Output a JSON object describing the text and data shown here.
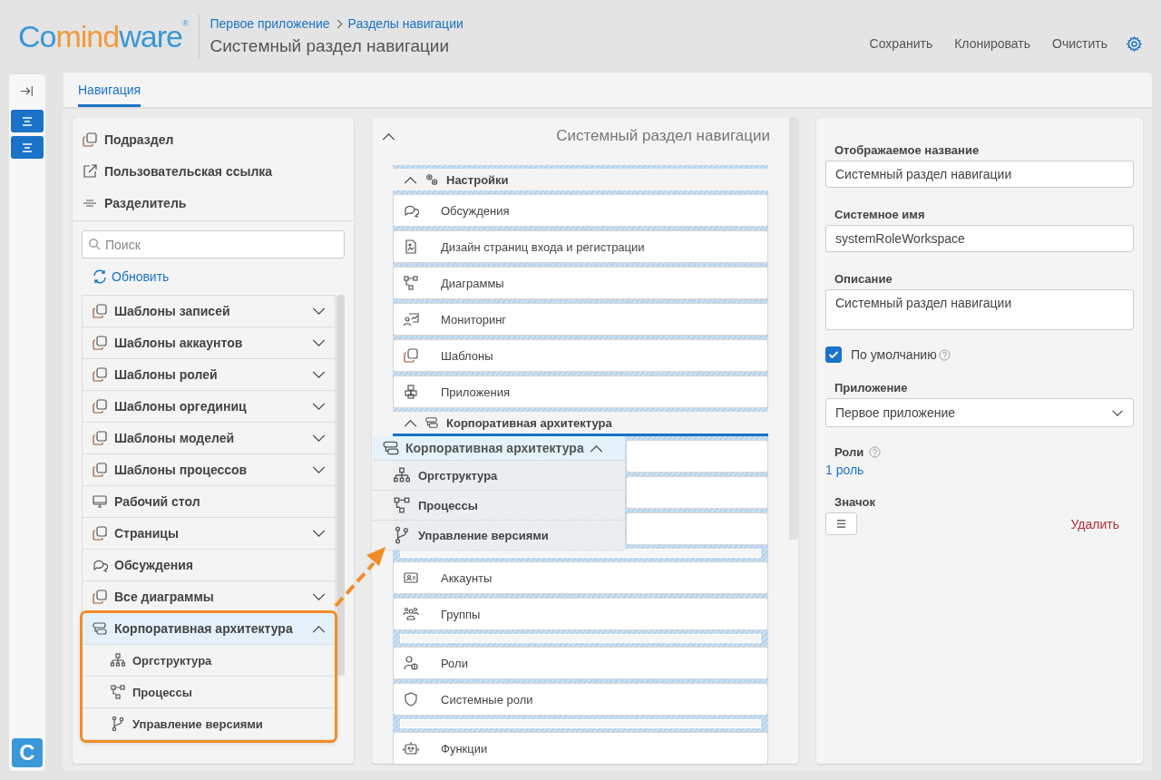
{
  "logo": {
    "parts": [
      {
        "text": "Co",
        "accent": false
      },
      {
        "text": "mind",
        "accent": true
      },
      {
        "text": "ware",
        "accent": false
      }
    ],
    "mark": "®"
  },
  "breadcrumbs": [
    "Первое приложение",
    "Разделы навигации"
  ],
  "page_title": "Системный раздел навигации",
  "actions": [
    "Сохранить",
    "Клонировать",
    "Очистить"
  ],
  "rail": {
    "buttons": [
      {
        "selected": true
      },
      {
        "selected": true
      }
    ],
    "app_badge": "C"
  },
  "tabs": [
    {
      "label": "Навигация",
      "selected": true
    }
  ],
  "palette": {
    "create_items": [
      {
        "kind": "subsection",
        "label": "Подраздел"
      },
      {
        "kind": "link",
        "label": "Пользовательская ссылка"
      },
      {
        "kind": "divider",
        "label": "Разделитель"
      }
    ],
    "search": {
      "placeholder": "Поиск"
    },
    "refresh": "Обновить",
    "items": [
      {
        "kind": "templates",
        "label": "Шаблоны записей",
        "expandable": true,
        "expanded": false,
        "selected": false,
        "annotated": false
      },
      {
        "kind": "templates",
        "label": "Шаблоны аккаунтов",
        "expandable": true,
        "expanded": false,
        "selected": false,
        "annotated": false
      },
      {
        "kind": "templates",
        "label": "Шаблоны ролей",
        "expandable": true,
        "expanded": false,
        "selected": false,
        "annotated": false
      },
      {
        "kind": "templates",
        "label": "Шаблоны оргединиц",
        "expandable": true,
        "expanded": false,
        "selected": false,
        "annotated": false
      },
      {
        "kind": "templates",
        "label": "Шаблоны моделей",
        "expandable": true,
        "expanded": false,
        "selected": false,
        "annotated": false
      },
      {
        "kind": "templates",
        "label": "Шаблоны процессов",
        "expandable": true,
        "expanded": false,
        "selected": false,
        "annotated": false
      },
      {
        "kind": "desktop",
        "label": "Рабочий стол",
        "expandable": false,
        "selected": false,
        "annotated": false
      },
      {
        "kind": "templates",
        "label": "Страницы",
        "expandable": true,
        "expanded": false,
        "selected": false,
        "annotated": false
      },
      {
        "kind": "discussions",
        "label": "Обсуждения",
        "expandable": false,
        "selected": false,
        "annotated": false
      },
      {
        "kind": "templates",
        "label": "Все диаграммы",
        "expandable": true,
        "expanded": false,
        "selected": false,
        "annotated": false
      },
      {
        "kind": "architecture",
        "label": "Корпоративная архитектура",
        "expandable": true,
        "expanded": true,
        "selected": true,
        "annotated": true,
        "children": [
          {
            "kind": "orgstructure",
            "label": "Оргструктура"
          },
          {
            "kind": "processes",
            "label": "Процессы"
          },
          {
            "kind": "versions",
            "label": "Управление версиями"
          }
        ]
      }
    ]
  },
  "structure": {
    "title": "Системный раздел навигации",
    "expanded": true,
    "entries": [
      {
        "kind": "settings_group",
        "label": "Настройки",
        "expanded": true,
        "drop_target": false,
        "children": [
          {
            "kind": "discussions",
            "label": "Обсуждения"
          },
          {
            "kind": "login_design",
            "label": "Дизайн страниц входа и регистрации"
          },
          {
            "kind": "diagrams",
            "label": "Диаграммы"
          },
          {
            "kind": "monitoring",
            "label": "Мониторинг"
          },
          {
            "kind": "templates",
            "label": "Шаблоны"
          },
          {
            "kind": "apps",
            "label": "Приложения"
          }
        ]
      },
      {
        "kind": "architecture_group",
        "label": "Корпоративная архитектура",
        "expanded": true,
        "drop_target": true
      },
      {
        "kind": "separator"
      },
      {
        "kind": "accounts",
        "label": "Аккаунты"
      },
      {
        "kind": "groups",
        "label": "Группы"
      },
      {
        "kind": "separator"
      },
      {
        "kind": "roles",
        "label": "Роли"
      },
      {
        "kind": "system_roles",
        "label": "Системные роли"
      },
      {
        "kind": "separator"
      },
      {
        "kind": "functions",
        "label": "Функции"
      }
    ]
  },
  "drag_ghost": {
    "kind": "architecture",
    "label": "Корпоративная архитектура",
    "expanded": true,
    "children": [
      {
        "kind": "orgstructure",
        "label": "Оргструктура"
      },
      {
        "kind": "processes",
        "label": "Процессы"
      },
      {
        "kind": "versions",
        "label": "Управление версиями"
      }
    ]
  },
  "properties": {
    "display_name": {
      "label": "Отображаемое название",
      "value": "Системный раздел навигации"
    },
    "system_name": {
      "label": "Системное имя",
      "value": "systemRoleWorkspace"
    },
    "description": {
      "label": "Описание",
      "value": "Системный раздел навигации"
    },
    "default": {
      "label": "По умолчанию",
      "checked": true
    },
    "application": {
      "label": "Приложение",
      "value": "Первое приложение"
    },
    "roles": {
      "label": "Роли",
      "link": "1 роль"
    },
    "icon": {
      "label": "Значок",
      "delete": "Удалить"
    }
  }
}
